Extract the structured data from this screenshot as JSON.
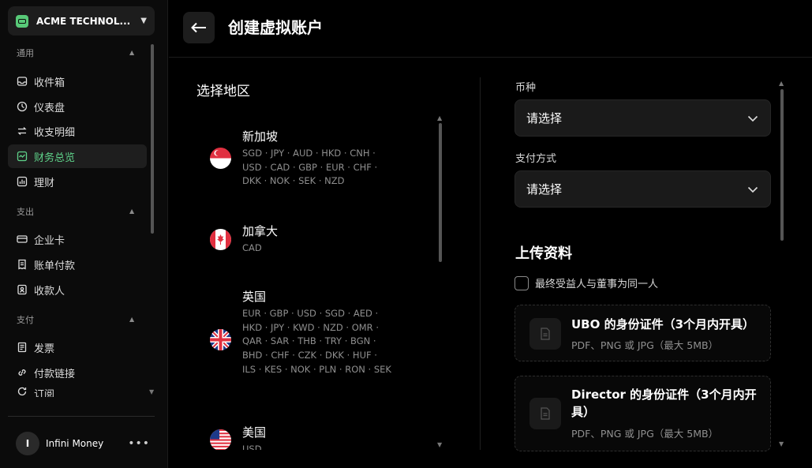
{
  "org": {
    "name": "ACME TECHNOL..."
  },
  "sections": [
    {
      "label": "通用"
    },
    {
      "label": "支出"
    },
    {
      "label": "支付"
    }
  ],
  "nav": [
    {
      "label": "收件箱",
      "icon": "inbox-icon"
    },
    {
      "label": "仪表盘",
      "icon": "dashboard-icon"
    },
    {
      "label": "收支明细",
      "icon": "transactions-icon"
    },
    {
      "label": "财务总览",
      "icon": "finance-overview-icon",
      "active": true
    },
    {
      "label": "理财",
      "icon": "wealth-icon"
    },
    {
      "label": "企业卡",
      "icon": "card-icon"
    },
    {
      "label": "账单付款",
      "icon": "bill-icon"
    },
    {
      "label": "收款人",
      "icon": "payee-icon"
    },
    {
      "label": "发票",
      "icon": "invoice-icon"
    },
    {
      "label": "付款链接",
      "icon": "link-icon"
    },
    {
      "label": "订阅",
      "icon": "subscription-icon"
    }
  ],
  "user": {
    "initial": "I",
    "name": "Infini Money",
    "more": "•••"
  },
  "header": {
    "title": "创建虚拟账户",
    "back": "←"
  },
  "region_panel": {
    "title": "选择地区",
    "regions": [
      {
        "name": "新加坡",
        "flag": "sg-flag-icon",
        "currencies": "SGD · JPY · AUD · HKD · CNH · USD · CAD · GBP · EUR · CHF · DKK · NOK · SEK · NZD"
      },
      {
        "name": "加拿大",
        "flag": "ca-flag-icon",
        "currencies": "CAD"
      },
      {
        "name": "英国",
        "flag": "uk-flag-icon",
        "currencies": "EUR · GBP · USD · SGD · AED · HKD · JPY · KWD · NZD · OMR · QAR · SAR · THB · TRY · BGN · BHD · CHF · CZK · DKK · HUF · ILS · KES · NOK · PLN · RON · SEK"
      },
      {
        "name": "美国",
        "flag": "us-flag-icon",
        "currencies": "USD"
      }
    ]
  },
  "form": {
    "currency_label": "币种",
    "currency_value": "请选择",
    "payment_label": "支付方式",
    "payment_value": "请选择",
    "upload_title": "上传资料",
    "checkbox_label": "最终受益人与董事为同一人",
    "cards": [
      {
        "title": "UBO 的身份证件（3个月内开具）",
        "sub": "PDF、PNG 或 JPG（最大 5MB）"
      },
      {
        "title": "Director 的身份证件（3个月内开具）",
        "sub": "PDF、PNG 或 JPG（最大 5MB）"
      }
    ]
  },
  "colors": {
    "accent": "#5fd38a",
    "background": "#000000",
    "panel": "#1a1a1a"
  }
}
